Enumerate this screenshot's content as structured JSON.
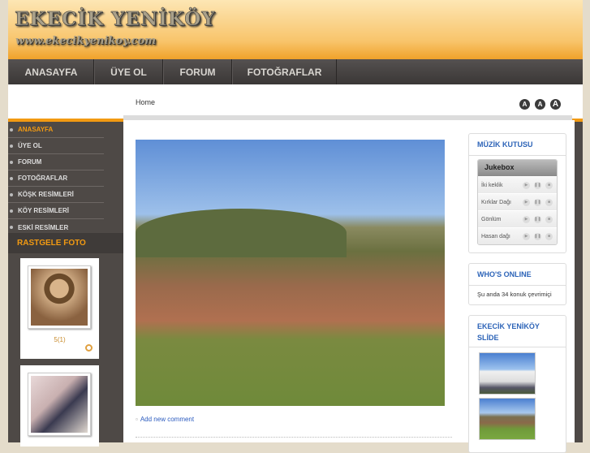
{
  "header": {
    "logo_title": "EKECİK YENİKÖY",
    "logo_url": "www.ekecikyenikoy.com"
  },
  "nav": [
    "ANASAYFA",
    "ÜYE OL",
    "FORUM",
    "FOTOĞRAFLAR"
  ],
  "breadcrumb": {
    "home": "Home"
  },
  "font_sizes": [
    "A",
    "A",
    "A"
  ],
  "sidebar": {
    "items": [
      "ANASAYFA",
      "ÜYE OL",
      "FORUM",
      "FOTOĞRAFLAR",
      "KÖŞK RESİMLERİ",
      "KÖY RESİMLERİ",
      "ESKİ RESİMLER"
    ],
    "random_title": "RASTGELE FOTO",
    "photo_caption": "5(1)"
  },
  "main": {
    "add_comment": "Add new comment"
  },
  "music": {
    "title": "MÜZİK KUTUSU",
    "jukebox": "Jukebox",
    "tracks": [
      "İki keklik",
      "Kırklar Dağı",
      "Gönlüm",
      "Hasan dağı"
    ]
  },
  "online": {
    "title": "WHO'S ONLINE",
    "text": "Şu anda 34 konuk çevrimiçi"
  },
  "slide": {
    "title": "EKECİK YENİKÖY SLİDE"
  },
  "colors": {
    "accent": "#f29a12",
    "link": "#2d64b8",
    "sidebar": "#4e4946"
  }
}
